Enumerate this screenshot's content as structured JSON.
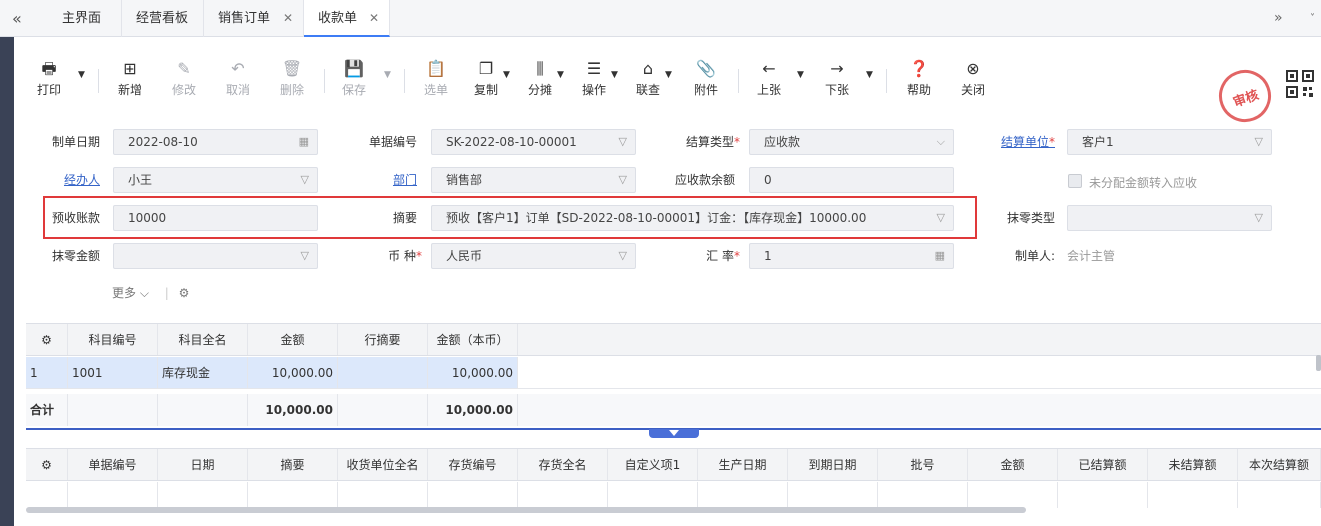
{
  "tabs": [
    {
      "label": "主界面",
      "closable": false,
      "active": false
    },
    {
      "label": "经营看板",
      "closable": false,
      "active": false
    },
    {
      "label": "销售订单",
      "closable": true,
      "active": false
    },
    {
      "label": "收款单",
      "closable": true,
      "active": true
    }
  ],
  "toolbar": {
    "print": "打印",
    "new": "新增",
    "edit": "修改",
    "cancel": "取消",
    "delete": "删除",
    "save": "保存",
    "select": "选单",
    "copy": "复制",
    "split": "分摊",
    "operate": "操作",
    "query": "联查",
    "attach": "附件",
    "prev": "上张",
    "next": "下张",
    "help": "帮助",
    "close": "关闭"
  },
  "stamp": {
    "text": "审核",
    "color": "#e05555"
  },
  "form": {
    "date_label": "制单日期",
    "date_value": "2022-08-10",
    "docno_label": "单据编号",
    "docno_value": "SK-2022-08-10-00001",
    "settle_type_label": "结算类型",
    "settle_type_value": "应收款",
    "settle_unit_label": "结算单位",
    "settle_unit_value": "客户1",
    "handler_label": "经办人",
    "handler_value": "小王",
    "dept_label": "部门",
    "dept_value": "销售部",
    "receivable_label": "应收款余额",
    "receivable_value": "0",
    "unallocated_label": "未分配金额转入应收",
    "prepay_label": "预收账款",
    "prepay_value": "10000",
    "summary_label": "摘要",
    "summary_value": "预收【客户1】订单【SD-2022-08-10-00001】订金：【库存现金】10000.00",
    "round_type_label": "抹零类型",
    "round_amount_label": "抹零金额",
    "currency_label": "币 种",
    "currency_value": "人民币",
    "rate_label": "汇 率",
    "rate_value": "1",
    "maker_label": "制单人:",
    "maker_value": "会计主管",
    "more_label": "更多"
  },
  "grid1": {
    "headers": [
      "科目编号",
      "科目全名",
      "金额",
      "行摘要",
      "金额（本币）"
    ],
    "rows": [
      {
        "idx": "1",
        "code": "1001",
        "name": "库存现金",
        "amount": "10,000.00",
        "memo": "",
        "amount_local": "10,000.00"
      }
    ],
    "total": {
      "label": "合计",
      "amount": "10,000.00",
      "amount_local": "10,000.00"
    }
  },
  "grid2": {
    "headers": [
      "单据编号",
      "日期",
      "摘要",
      "收货单位全名",
      "存货编号",
      "存货全名",
      "自定义项1",
      "生产日期",
      "到期日期",
      "批号",
      "金额",
      "已结算额",
      "未结算额",
      "本次结算额"
    ]
  },
  "colors": {
    "accent": "#3d7cf5",
    "highlight_row": "#dce8fb",
    "required": "#e04040",
    "callout": "#e0393a"
  }
}
